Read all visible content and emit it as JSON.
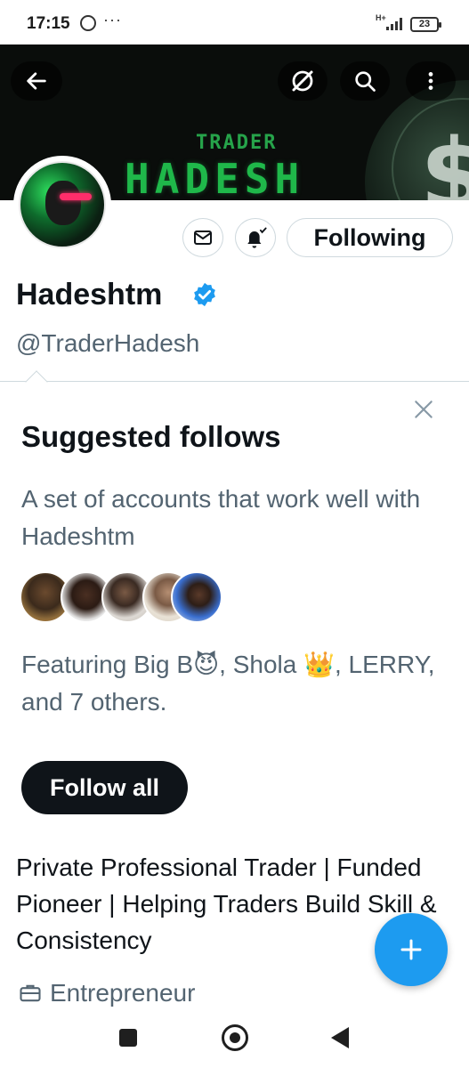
{
  "status_bar": {
    "time": "17:15",
    "dots": "···",
    "network": "H+",
    "battery": "23",
    "icons": [
      "whatsapp-icon",
      "signal-icon",
      "battery-icon"
    ]
  },
  "banner": {
    "line1": "TRADER",
    "line2": "HADESH",
    "dollar_glyph": "$"
  },
  "profile": {
    "display_name": "Hadeshtm",
    "handle": "@TraderHadesh",
    "following_label": "Following",
    "verified_color": "#1d9bf0"
  },
  "suggested": {
    "title": "Suggested follows",
    "description": "A set of accounts that work well with Hadeshtm",
    "featuring": "Featuring Big B😈, Shola 👑, LERRY, and 7 others.",
    "follow_all_label": "Follow all"
  },
  "bio": {
    "text": "Private Professional Trader | Funded Pioneer | Helping Traders Build Skill & Consistency",
    "job": "Entrepreneur"
  },
  "colors": {
    "accent": "#1d9bf0",
    "primary_text": "#0f1419",
    "secondary_text": "#536471",
    "banner_green": "#1fb84a"
  }
}
